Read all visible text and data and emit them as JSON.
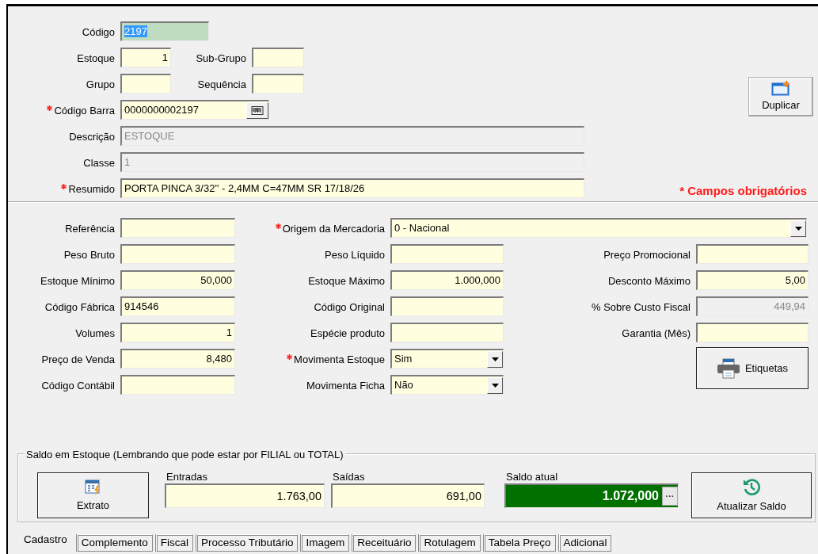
{
  "top": {
    "rows": [
      [
        {
          "label": "Código",
          "value": "2197",
          "kind": "key",
          "selected": true,
          "required": false,
          "disabled": false
        }
      ],
      [
        {
          "label": "Estoque",
          "value": "1",
          "kind": "number",
          "required": false,
          "disabled": false
        },
        {
          "label": "Sub-Grupo",
          "kind": "text",
          "required": false,
          "disabled": false
        }
      ],
      [
        {
          "label": "Grupo",
          "kind": "text",
          "required": false,
          "disabled": false
        },
        {
          "label": "Sequência",
          "kind": "text",
          "required": false,
          "disabled": false
        }
      ],
      [
        {
          "label": "Código Barra",
          "value": "0000000002197",
          "kind": "barcode",
          "required": true,
          "disabled": false
        }
      ],
      [
        {
          "label": "Descrição",
          "value": "ESTOQUE",
          "kind": "text",
          "required": false,
          "disabled": true
        }
      ],
      [
        {
          "label": "Classe",
          "value": "1",
          "kind": "text",
          "required": false,
          "disabled": true
        }
      ],
      [
        {
          "label": "Resumido",
          "value": "PORTA PINCA 3/32'' - 2,4MM C=47MM SR 17/18/26",
          "kind": "text",
          "required": true,
          "disabled": false
        }
      ]
    ],
    "duplicate_button": "Duplicar",
    "required_note": "* Campos obrigatórios"
  },
  "details": {
    "columns": [
      [
        {
          "label": "Referência",
          "kind": "text",
          "required": false,
          "disabled": false
        },
        {
          "label": "Peso Bruto",
          "kind": "text",
          "required": false,
          "disabled": false
        },
        {
          "label": "Estoque Mínimo",
          "value": "50,000",
          "kind": "number",
          "required": false,
          "disabled": false
        },
        {
          "label": "Código Fábrica",
          "value": "914546",
          "kind": "text",
          "required": false,
          "disabled": false
        },
        {
          "label": "Volumes",
          "value": "1",
          "kind": "number",
          "required": false,
          "disabled": false
        },
        {
          "label": "Preço de Venda",
          "value": "8,480",
          "kind": "number",
          "required": false,
          "disabled": false
        },
        {
          "label": "Código Contábil",
          "kind": "text",
          "required": false,
          "disabled": false
        }
      ],
      [
        {
          "label": "Origem  da Mercadoria",
          "value": "0 - Nacional",
          "kind": "select",
          "required": true,
          "disabled": false
        },
        {
          "label": "Peso Líquido",
          "kind": "text",
          "required": false,
          "disabled": false
        },
        {
          "label": "Estoque Máximo",
          "value": "1.000,000",
          "kind": "number",
          "required": false,
          "disabled": false
        },
        {
          "label": "Código Original",
          "kind": "text",
          "required": false,
          "disabled": false
        },
        {
          "label": "Espécie produto",
          "kind": "text",
          "required": false,
          "disabled": false
        },
        {
          "label": "Movimenta Estoque",
          "value": "Sim",
          "kind": "select",
          "required": true,
          "disabled": false
        },
        {
          "label": "Movimenta Ficha",
          "value": "Não",
          "kind": "select",
          "required": false,
          "disabled": false
        }
      ],
      [
        {
          "label": "Preço Promocional",
          "kind": "text",
          "required": false,
          "disabled": false
        },
        {
          "label": "Desconto Máximo",
          "value": "5,00",
          "kind": "number",
          "required": false,
          "disabled": false
        },
        {
          "label": "% Sobre Custo Fiscal",
          "value": "449,94",
          "kind": "number",
          "required": false,
          "disabled": true
        },
        {
          "label": "Garantia (Mês)",
          "kind": "text",
          "required": false,
          "disabled": false
        }
      ]
    ],
    "labels_button": "Etiquetas"
  },
  "stock": {
    "title": "Saldo em Estoque (Lembrando que pode estar por FILIAL ou TOTAL)",
    "statement_button": "Extrato",
    "entries": {
      "label": "Entradas",
      "value": "1.763,00"
    },
    "exits": {
      "label": "Saídas",
      "value": "691,00"
    },
    "balance": {
      "label": "Saldo atual",
      "value": "1.072,000",
      "ellipsis": "···"
    },
    "refresh_button": "Atualizar Saldo"
  },
  "tabs": [
    {
      "label": "Cadastro",
      "selected": true
    },
    {
      "label": "Complemento",
      "selected": false
    },
    {
      "label": "Fiscal",
      "selected": false
    },
    {
      "label": "Processo Tributário",
      "selected": false
    },
    {
      "label": "Imagem",
      "selected": false
    },
    {
      "label": "Receituário",
      "selected": false
    },
    {
      "label": "Rotulagem",
      "selected": false
    },
    {
      "label": "Tabela Preço",
      "selected": false
    },
    {
      "label": "Adicional",
      "selected": false
    }
  ]
}
